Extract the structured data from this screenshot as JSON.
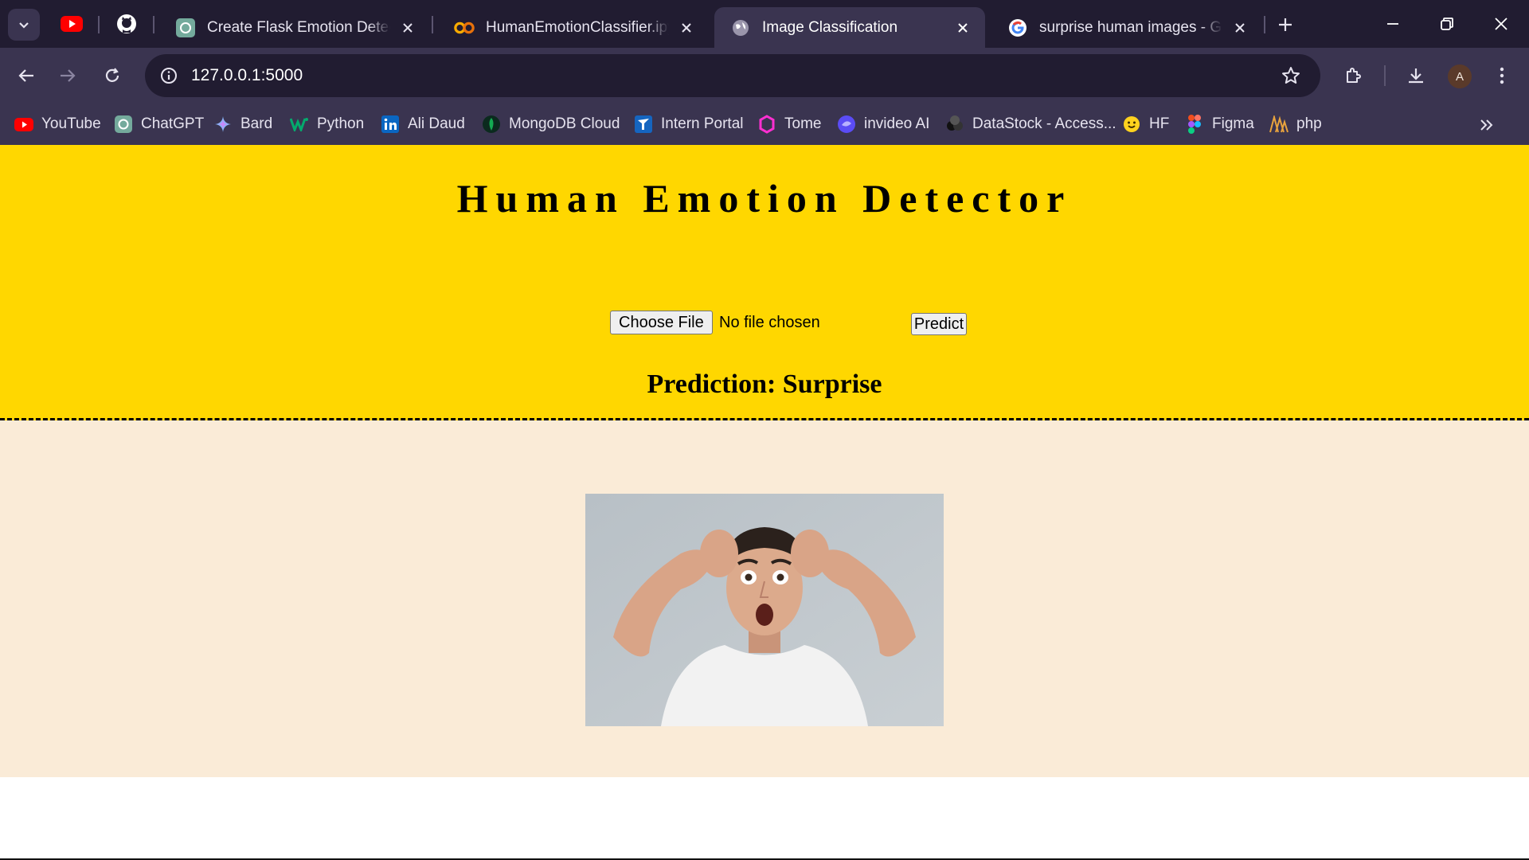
{
  "browser": {
    "tabs": [
      {
        "title": "Create Flask Emotion Detection",
        "favicon": "chatgpt-icon",
        "active": false
      },
      {
        "title": "HumanEmotionClassifier.ipynb",
        "favicon": "colab-icon",
        "active": false
      },
      {
        "title": "Image Classification",
        "favicon": "globe-icon",
        "active": true
      },
      {
        "title": "surprise human images - Google",
        "favicon": "google-icon",
        "active": false
      }
    ],
    "pinned": [
      "youtube-icon",
      "github-icon"
    ],
    "url": "127.0.0.1:5000",
    "profile_initial": "A"
  },
  "bookmarks": [
    {
      "label": "YouTube",
      "icon": "youtube-icon"
    },
    {
      "label": "ChatGPT",
      "icon": "chatgpt-icon"
    },
    {
      "label": "Bard",
      "icon": "bard-icon"
    },
    {
      "label": "Python",
      "icon": "python-icon"
    },
    {
      "label": "Ali Daud",
      "icon": "linkedin-icon"
    },
    {
      "label": "MongoDB Cloud",
      "icon": "mongodb-icon"
    },
    {
      "label": "Intern Portal",
      "icon": "intern-portal-icon"
    },
    {
      "label": "Tome",
      "icon": "tome-icon"
    },
    {
      "label": "invideo AI",
      "icon": "invideo-icon"
    },
    {
      "label": "DataStock - Access...",
      "icon": "datastock-icon"
    },
    {
      "label": "HF",
      "icon": "huggingface-icon"
    },
    {
      "label": "Figma",
      "icon": "figma-icon"
    },
    {
      "label": "php",
      "icon": "php-icon"
    }
  ],
  "page": {
    "heading": "Human Emotion Detector",
    "file_button": "Choose File",
    "file_status": "No file chosen",
    "predict_button": "Predict",
    "prediction": "Prediction: Surprise"
  },
  "colors": {
    "hero_bg": "#ffd700",
    "result_bg": "#faebd7",
    "tabstrip_bg": "#211c31",
    "toolbar_bg": "#3a3450"
  }
}
